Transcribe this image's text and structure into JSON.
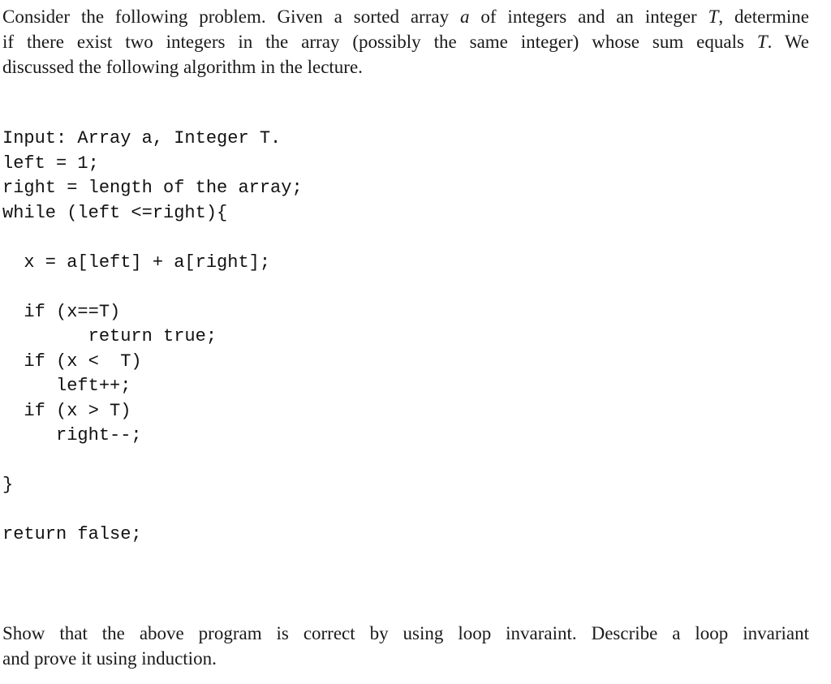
{
  "intro": {
    "line1_pre": "Consider the following problem.  Given a sorted array ",
    "var_a": "a",
    "line1_mid": " of integers and an integer ",
    "var_T1": "T",
    "line1_post": ", determine",
    "line2_pre": "if there exist two integers in the array (possibly the same integer) whose sum equals ",
    "var_T2": "T",
    "line2_post": ".  We",
    "line3": "discussed the following algorithm in the lecture."
  },
  "code": {
    "lines": [
      "Input: Array a, Integer T.",
      "left = 1;",
      "right = length of the array;",
      "while (left <=right){",
      "",
      "  x = a[left] + a[right];",
      "",
      "  if (x==T)",
      "        return true;",
      "  if (x <  T)",
      "     left++;",
      "  if (x > T)",
      "     right--;",
      "",
      "}",
      "",
      "return false;"
    ]
  },
  "task": {
    "line1": "Show that the above program is correct by using loop invaraint.  Describe a loop invariant",
    "line2": "and prove it using induction."
  }
}
